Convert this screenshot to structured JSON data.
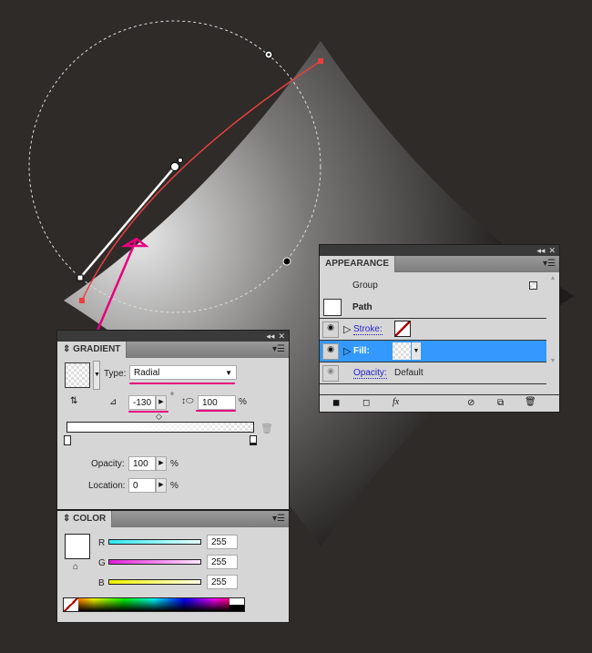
{
  "gradient_panel": {
    "title": "GRADIENT",
    "type_label": "Type:",
    "type_value": "Radial",
    "angle_value": "-130",
    "degree_symbol": "°",
    "aspect_value": "100",
    "percent": "%",
    "opacity_label": "Opacity:",
    "opacity_value": "100",
    "location_label": "Location:",
    "location_value": "0"
  },
  "color_panel": {
    "title": "COLOR",
    "r_label": "R",
    "g_label": "G",
    "b_label": "B",
    "r_value": "255",
    "g_value": "255",
    "b_value": "255"
  },
  "appearance_panel": {
    "title": "APPEARANCE",
    "group_label": "Group",
    "path_label": "Path",
    "stroke_label": "Stroke:",
    "fill_label": "Fill:",
    "opacity_label": "Opacity:",
    "opacity_value": "Default"
  },
  "colors": {
    "accent_pink": "#e6007e",
    "selection_blue": "#3399ff",
    "path_red": "#e84040"
  }
}
